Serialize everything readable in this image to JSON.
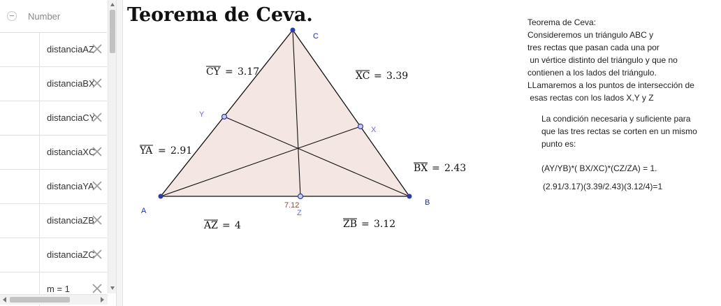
{
  "algebra": {
    "header_label": "Number",
    "rows": [
      {
        "text": "distanciaAZ"
      },
      {
        "text": "distanciaBX"
      },
      {
        "text": "distanciaCY"
      },
      {
        "text": "distanciaXC"
      },
      {
        "text": "distanciaYA"
      },
      {
        "text": "distanciaZB"
      },
      {
        "text": "distanciaZC"
      },
      {
        "text": "m = 1"
      }
    ]
  },
  "title": "Teorema de Ceva.",
  "points": {
    "A": "A",
    "B": "B",
    "C": "C",
    "X": "X",
    "Y": "Y",
    "Z": "Z"
  },
  "segment_labels": {
    "cy": "3.17",
    "xc": "3.39",
    "ya": "2.91",
    "bx": "2.43",
    "az": "4",
    "zb": "3.12"
  },
  "segment_names": {
    "cy": "CY",
    "xc": "XC",
    "ya": "YA",
    "bx": "BX",
    "az": "AZ",
    "zb": "ZB"
  },
  "az_value": "7.12",
  "description": {
    "lines": [
      "Teorema de Ceva:",
      "Consideremos un triángulo ABC y",
      "tres rectas que pasan cada una por",
      " un vértice distinto del triángulo y que no",
      "contienen a los lados del triángulo.",
      "LLamaremos a los puntos de intersección de",
      " esas rectas con los lados X,Y y Z"
    ],
    "condition_lines": [
      "La condición necesaria y suficiente para",
      "que las tres rectas se corten en un mismo",
      "punto es:"
    ],
    "formula": "(AY/YB)*( BX/XC)*(CZ/ZA) = 1.",
    "evaluation": "(2.91/3.17)(3.39/2.43)(3.12/4)=1"
  },
  "colors": {
    "triangle_fill": "#f3e6e3",
    "point_fill": "#2e3ca6",
    "point_label": "#3a3ad0",
    "value_label": "#8a4a2a",
    "cevian": "#111111"
  }
}
